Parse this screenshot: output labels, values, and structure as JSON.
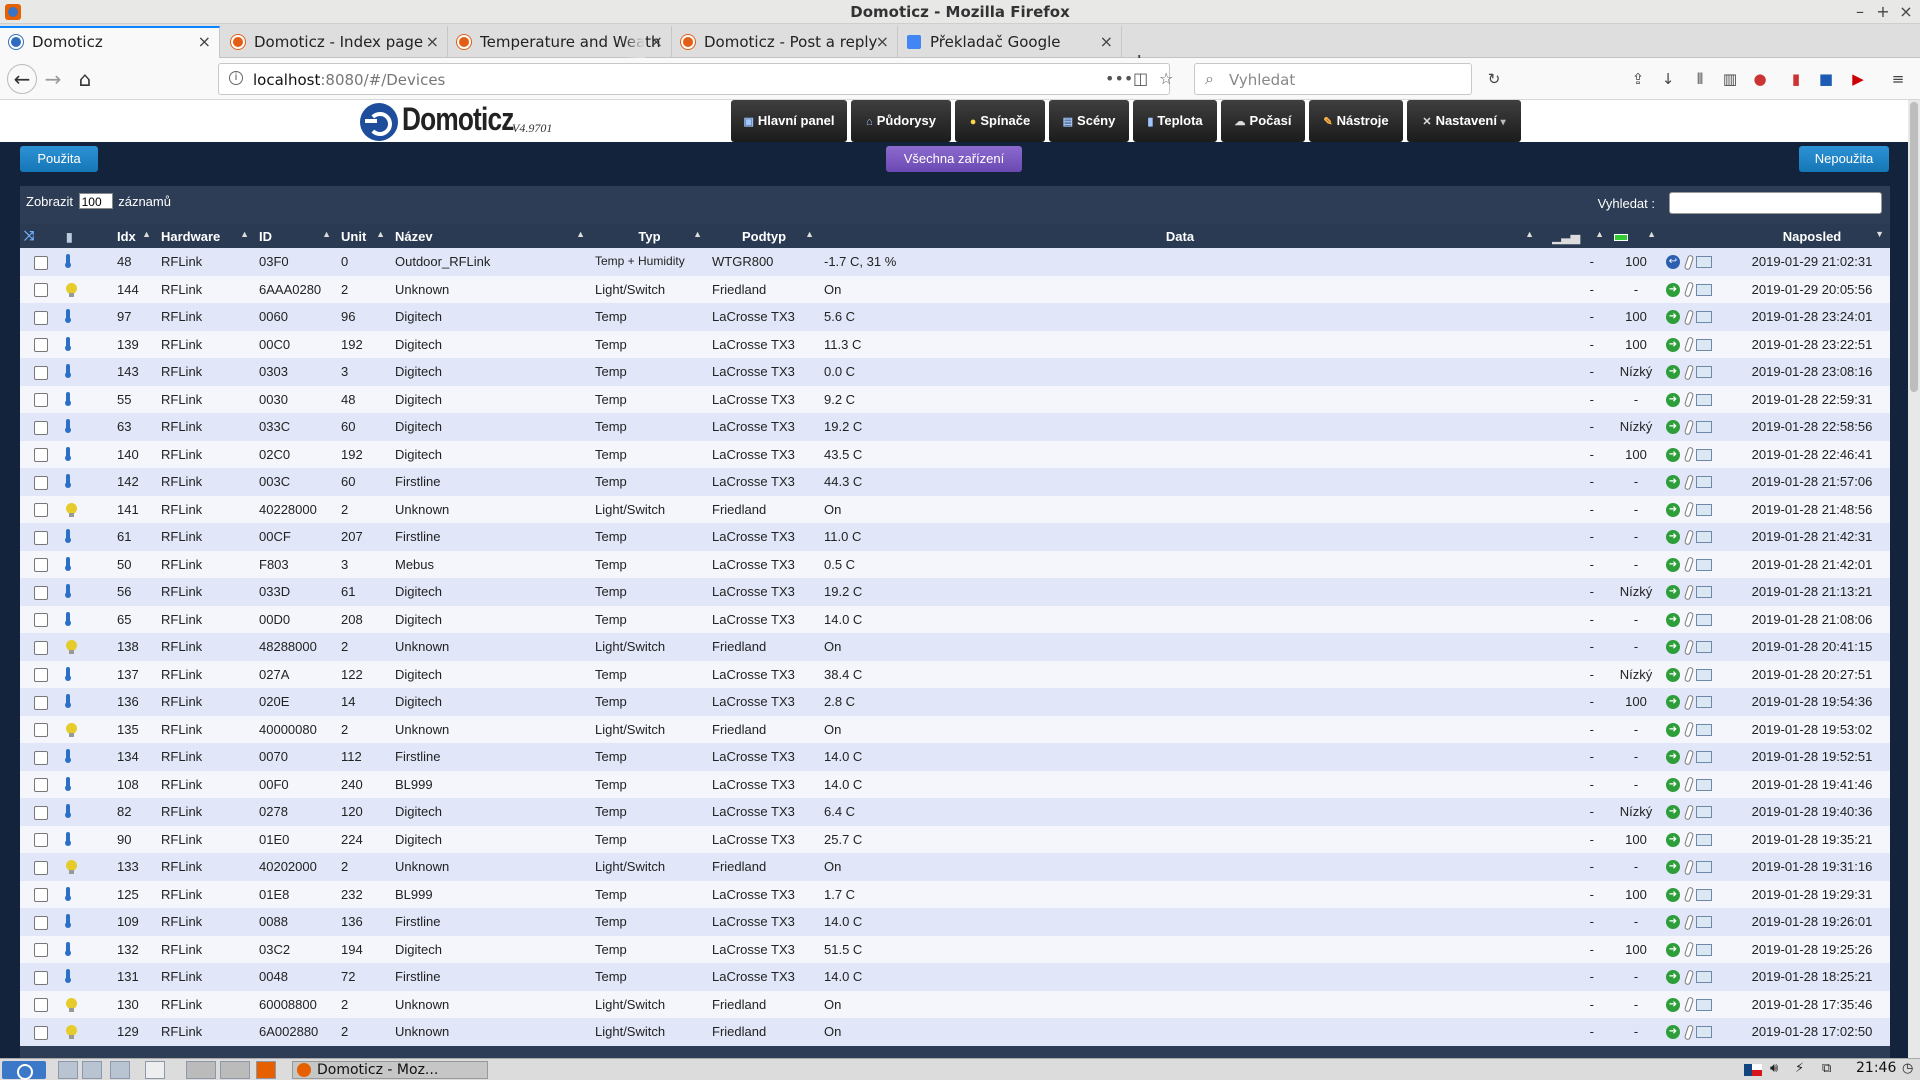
{
  "window": {
    "title": "Domoticz - Mozilla Firefox",
    "minimize": "–",
    "maximize": "+",
    "close": "×"
  },
  "tabs": [
    {
      "label": "Domoticz",
      "icon": "domoticz-favicon"
    },
    {
      "label": "Domoticz - Index page",
      "icon": "domoticz-forum-favicon"
    },
    {
      "label": "Temperature and Weath",
      "icon": "domoticz-forum-favicon"
    },
    {
      "label": "Domoticz - Post a reply",
      "icon": "domoticz-forum-favicon"
    },
    {
      "label": "Překladač Google",
      "icon": "google-translate-favicon"
    }
  ],
  "nav": {
    "url_host": "localhost",
    "url_rest": ":8080/#/Devices",
    "search_placeholder": "Vyhledat",
    "more": "•••"
  },
  "domoticz": {
    "logo": "Domoticz",
    "version": "V4.9701",
    "menu": [
      "Hlavní panel",
      "Půdorysy",
      "Spínače",
      "Scény",
      "Teplota",
      "Počasí",
      "Nástroje",
      "Nastavení"
    ],
    "menu_dropdown_caret": "▾",
    "btn_used": "Použita",
    "btn_all": "Všechna zařízení",
    "btn_unused": "Nepoužita",
    "show_prefix": "Zobrazit",
    "show_value": "100",
    "show_suffix": "záznamů",
    "search_label": "Vyhledat :",
    "columns": {
      "idx": "Idx",
      "hardware": "Hardware",
      "id": "ID",
      "unit": "Unit",
      "name": "Název",
      "type": "Typ",
      "subtype": "Podtyp",
      "data": "Data",
      "lastseen": "Naposled"
    }
  },
  "devices": [
    {
      "kind": "temp",
      "idx": "48",
      "hw": "RFLink",
      "id": "03F0",
      "unit": "0",
      "name": "Outdoor_RFLink",
      "type": "Temp + Humidity",
      "subtype": "WTGR800",
      "data": "-1.7 C, 31 %",
      "signal": "-",
      "battery": "100",
      "state": "blue",
      "last": "2019-01-29 21:02:31"
    },
    {
      "kind": "light",
      "idx": "144",
      "hw": "RFLink",
      "id": "6AAA0280",
      "unit": "2",
      "name": "Unknown",
      "type": "Light/Switch",
      "subtype": "Friedland",
      "data": "On",
      "signal": "-",
      "battery": "-",
      "state": "green",
      "last": "2019-01-29 20:05:56"
    },
    {
      "kind": "temp",
      "idx": "97",
      "hw": "RFLink",
      "id": "0060",
      "unit": "96",
      "name": "Digitech",
      "type": "Temp",
      "subtype": "LaCrosse TX3",
      "data": "5.6 C",
      "signal": "-",
      "battery": "100",
      "state": "green",
      "last": "2019-01-28 23:24:01"
    },
    {
      "kind": "temp",
      "idx": "139",
      "hw": "RFLink",
      "id": "00C0",
      "unit": "192",
      "name": "Digitech",
      "type": "Temp",
      "subtype": "LaCrosse TX3",
      "data": "11.3 C",
      "signal": "-",
      "battery": "100",
      "state": "green",
      "last": "2019-01-28 23:22:51"
    },
    {
      "kind": "temp",
      "idx": "143",
      "hw": "RFLink",
      "id": "0303",
      "unit": "3",
      "name": "Digitech",
      "type": "Temp",
      "subtype": "LaCrosse TX3",
      "data": "0.0 C",
      "signal": "-",
      "battery": "Nízký",
      "state": "green",
      "last": "2019-01-28 23:08:16"
    },
    {
      "kind": "temp",
      "idx": "55",
      "hw": "RFLink",
      "id": "0030",
      "unit": "48",
      "name": "Digitech",
      "type": "Temp",
      "subtype": "LaCrosse TX3",
      "data": "9.2 C",
      "signal": "-",
      "battery": "-",
      "state": "green",
      "last": "2019-01-28 22:59:31"
    },
    {
      "kind": "temp",
      "idx": "63",
      "hw": "RFLink",
      "id": "033C",
      "unit": "60",
      "name": "Digitech",
      "type": "Temp",
      "subtype": "LaCrosse TX3",
      "data": "19.2 C",
      "signal": "-",
      "battery": "Nízký",
      "state": "green",
      "last": "2019-01-28 22:58:56"
    },
    {
      "kind": "temp",
      "idx": "140",
      "hw": "RFLink",
      "id": "02C0",
      "unit": "192",
      "name": "Digitech",
      "type": "Temp",
      "subtype": "LaCrosse TX3",
      "data": "43.5 C",
      "signal": "-",
      "battery": "100",
      "state": "green",
      "last": "2019-01-28 22:46:41"
    },
    {
      "kind": "temp",
      "idx": "142",
      "hw": "RFLink",
      "id": "003C",
      "unit": "60",
      "name": "Firstline",
      "type": "Temp",
      "subtype": "LaCrosse TX3",
      "data": "44.3 C",
      "signal": "-",
      "battery": "-",
      "state": "green",
      "last": "2019-01-28 21:57:06"
    },
    {
      "kind": "light",
      "idx": "141",
      "hw": "RFLink",
      "id": "40228000",
      "unit": "2",
      "name": "Unknown",
      "type": "Light/Switch",
      "subtype": "Friedland",
      "data": "On",
      "signal": "-",
      "battery": "-",
      "state": "green",
      "last": "2019-01-28 21:48:56"
    },
    {
      "kind": "temp",
      "idx": "61",
      "hw": "RFLink",
      "id": "00CF",
      "unit": "207",
      "name": "Firstline",
      "type": "Temp",
      "subtype": "LaCrosse TX3",
      "data": "11.0 C",
      "signal": "-",
      "battery": "-",
      "state": "green",
      "last": "2019-01-28 21:42:31"
    },
    {
      "kind": "temp",
      "idx": "50",
      "hw": "RFLink",
      "id": "F803",
      "unit": "3",
      "name": "Mebus",
      "type": "Temp",
      "subtype": "LaCrosse TX3",
      "data": "0.5 C",
      "signal": "-",
      "battery": "-",
      "state": "green",
      "last": "2019-01-28 21:42:01"
    },
    {
      "kind": "temp",
      "idx": "56",
      "hw": "RFLink",
      "id": "033D",
      "unit": "61",
      "name": "Digitech",
      "type": "Temp",
      "subtype": "LaCrosse TX3",
      "data": "19.2 C",
      "signal": "-",
      "battery": "Nízký",
      "state": "green",
      "last": "2019-01-28 21:13:21"
    },
    {
      "kind": "temp",
      "idx": "65",
      "hw": "RFLink",
      "id": "00D0",
      "unit": "208",
      "name": "Digitech",
      "type": "Temp",
      "subtype": "LaCrosse TX3",
      "data": "14.0 C",
      "signal": "-",
      "battery": "-",
      "state": "green",
      "last": "2019-01-28 21:08:06"
    },
    {
      "kind": "light",
      "idx": "138",
      "hw": "RFLink",
      "id": "48288000",
      "unit": "2",
      "name": "Unknown",
      "type": "Light/Switch",
      "subtype": "Friedland",
      "data": "On",
      "signal": "-",
      "battery": "-",
      "state": "green",
      "last": "2019-01-28 20:41:15"
    },
    {
      "kind": "temp",
      "idx": "137",
      "hw": "RFLink",
      "id": "027A",
      "unit": "122",
      "name": "Digitech",
      "type": "Temp",
      "subtype": "LaCrosse TX3",
      "data": "38.4 C",
      "signal": "-",
      "battery": "Nízký",
      "state": "green",
      "last": "2019-01-28 20:27:51"
    },
    {
      "kind": "temp",
      "idx": "136",
      "hw": "RFLink",
      "id": "020E",
      "unit": "14",
      "name": "Digitech",
      "type": "Temp",
      "subtype": "LaCrosse TX3",
      "data": "2.8 C",
      "signal": "-",
      "battery": "100",
      "state": "green",
      "last": "2019-01-28 19:54:36"
    },
    {
      "kind": "light",
      "idx": "135",
      "hw": "RFLink",
      "id": "40000080",
      "unit": "2",
      "name": "Unknown",
      "type": "Light/Switch",
      "subtype": "Friedland",
      "data": "On",
      "signal": "-",
      "battery": "-",
      "state": "green",
      "last": "2019-01-28 19:53:02"
    },
    {
      "kind": "temp",
      "idx": "134",
      "hw": "RFLink",
      "id": "0070",
      "unit": "112",
      "name": "Firstline",
      "type": "Temp",
      "subtype": "LaCrosse TX3",
      "data": "14.0 C",
      "signal": "-",
      "battery": "-",
      "state": "green",
      "last": "2019-01-28 19:52:51"
    },
    {
      "kind": "temp",
      "idx": "108",
      "hw": "RFLink",
      "id": "00F0",
      "unit": "240",
      "name": "BL999",
      "type": "Temp",
      "subtype": "LaCrosse TX3",
      "data": "14.0 C",
      "signal": "-",
      "battery": "-",
      "state": "green",
      "last": "2019-01-28 19:41:46"
    },
    {
      "kind": "temp",
      "idx": "82",
      "hw": "RFLink",
      "id": "0278",
      "unit": "120",
      "name": "Digitech",
      "type": "Temp",
      "subtype": "LaCrosse TX3",
      "data": "6.4 C",
      "signal": "-",
      "battery": "Nízký",
      "state": "green",
      "last": "2019-01-28 19:40:36"
    },
    {
      "kind": "temp",
      "idx": "90",
      "hw": "RFLink",
      "id": "01E0",
      "unit": "224",
      "name": "Digitech",
      "type": "Temp",
      "subtype": "LaCrosse TX3",
      "data": "25.7 C",
      "signal": "-",
      "battery": "100",
      "state": "green",
      "last": "2019-01-28 19:35:21"
    },
    {
      "kind": "light",
      "idx": "133",
      "hw": "RFLink",
      "id": "40202000",
      "unit": "2",
      "name": "Unknown",
      "type": "Light/Switch",
      "subtype": "Friedland",
      "data": "On",
      "signal": "-",
      "battery": "-",
      "state": "green",
      "last": "2019-01-28 19:31:16"
    },
    {
      "kind": "temp",
      "idx": "125",
      "hw": "RFLink",
      "id": "01E8",
      "unit": "232",
      "name": "BL999",
      "type": "Temp",
      "subtype": "LaCrosse TX3",
      "data": "1.7 C",
      "signal": "-",
      "battery": "100",
      "state": "green",
      "last": "2019-01-28 19:29:31"
    },
    {
      "kind": "temp",
      "idx": "109",
      "hw": "RFLink",
      "id": "0088",
      "unit": "136",
      "name": "Firstline",
      "type": "Temp",
      "subtype": "LaCrosse TX3",
      "data": "14.0 C",
      "signal": "-",
      "battery": "-",
      "state": "green",
      "last": "2019-01-28 19:26:01"
    },
    {
      "kind": "temp",
      "idx": "132",
      "hw": "RFLink",
      "id": "03C2",
      "unit": "194",
      "name": "Digitech",
      "type": "Temp",
      "subtype": "LaCrosse TX3",
      "data": "51.5 C",
      "signal": "-",
      "battery": "100",
      "state": "green",
      "last": "2019-01-28 19:25:26"
    },
    {
      "kind": "temp",
      "idx": "131",
      "hw": "RFLink",
      "id": "0048",
      "unit": "72",
      "name": "Firstline",
      "type": "Temp",
      "subtype": "LaCrosse TX3",
      "data": "14.0 C",
      "signal": "-",
      "battery": "-",
      "state": "green",
      "last": "2019-01-28 18:25:21"
    },
    {
      "kind": "light",
      "idx": "130",
      "hw": "RFLink",
      "id": "60008800",
      "unit": "2",
      "name": "Unknown",
      "type": "Light/Switch",
      "subtype": "Friedland",
      "data": "On",
      "signal": "-",
      "battery": "-",
      "state": "green",
      "last": "2019-01-28 17:35:46"
    },
    {
      "kind": "light",
      "idx": "129",
      "hw": "RFLink",
      "id": "6A002880",
      "unit": "2",
      "name": "Unknown",
      "type": "Light/Switch",
      "subtype": "Friedland",
      "data": "On",
      "signal": "-",
      "battery": "-",
      "state": "green",
      "last": "2019-01-28 17:02:50"
    }
  ],
  "taskbar": {
    "task_label": "Domoticz - Moz...",
    "clock": "21:46",
    "tray_icons": [
      "flag-cz-icon",
      "volume-icon",
      "power-icon",
      "network-icon",
      "clock-icon"
    ]
  },
  "colors": {
    "header_dark": "#12233b",
    "row_odd": "#e1e7f8",
    "row_even": "#f4f6fc",
    "button_blue": "#1e86c8",
    "button_purple": "#7a5bc2",
    "status_green": "#2e9e3a"
  }
}
